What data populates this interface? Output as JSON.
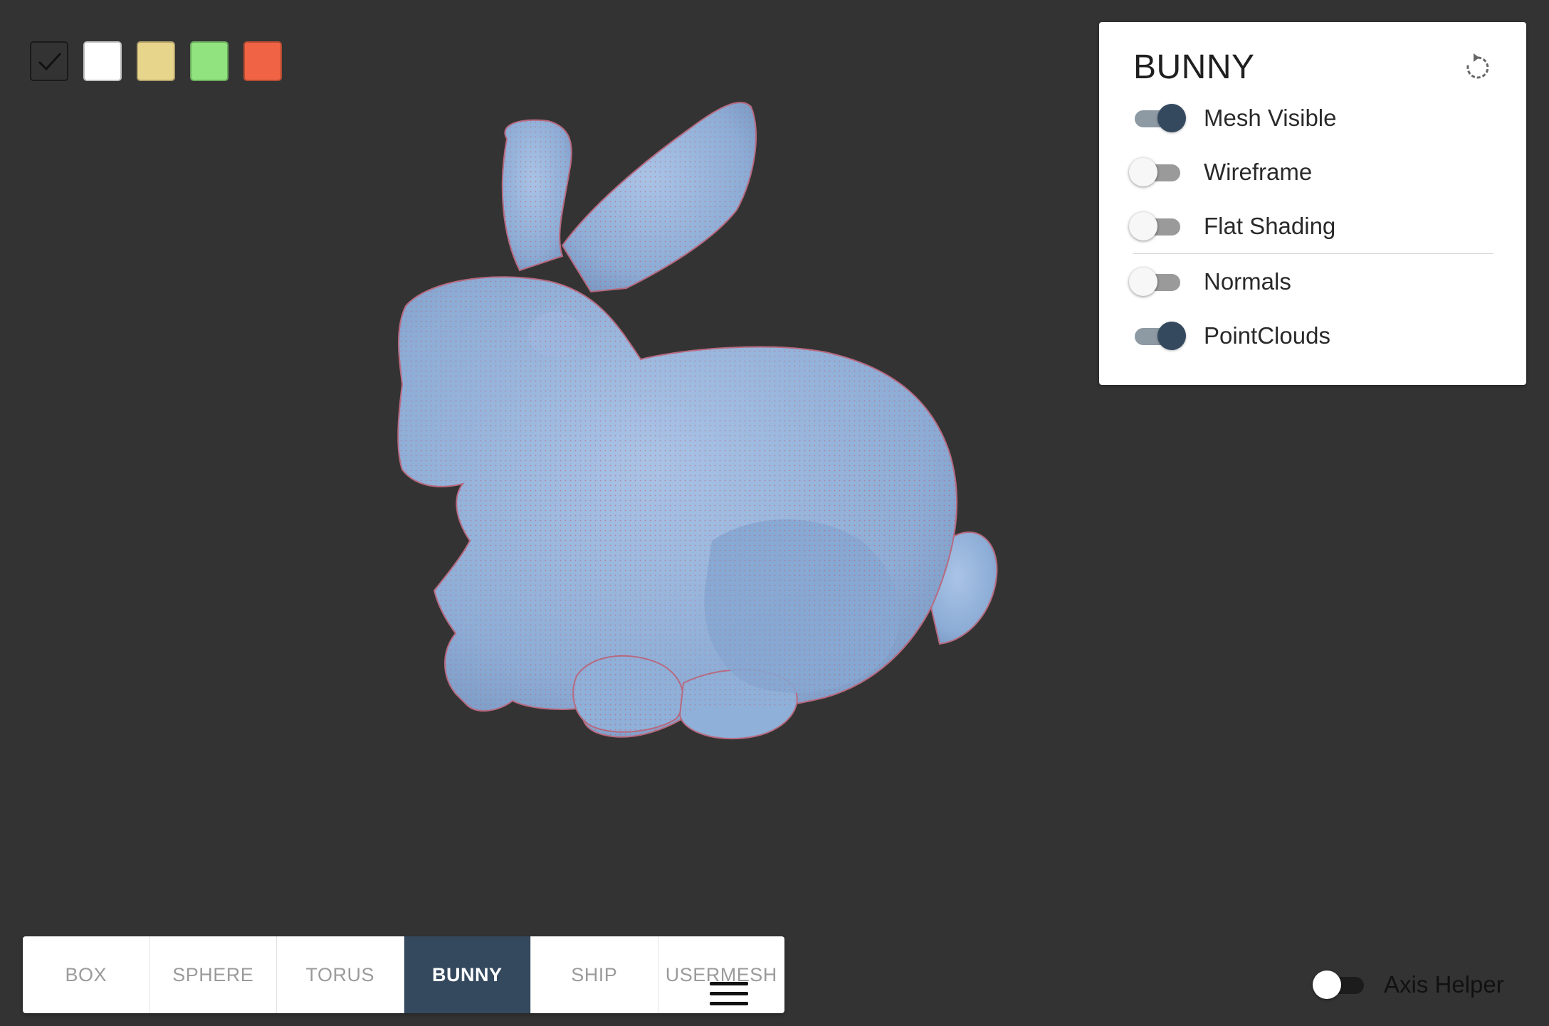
{
  "swatches": [
    {
      "name": "dark",
      "color": "#333333",
      "selected": true
    },
    {
      "name": "white",
      "color": "#ffffff",
      "selected": false
    },
    {
      "name": "yellow",
      "color": "#e8d58c",
      "selected": false
    },
    {
      "name": "green",
      "color": "#90e37e",
      "selected": false
    },
    {
      "name": "orange",
      "color": "#f06445",
      "selected": false
    }
  ],
  "viewport": {
    "model_color": "#8fb0d8",
    "point_color": "#c0566a",
    "background": "#333333"
  },
  "panel": {
    "title": "BUNNY",
    "reset_icon": "rotate-ccw-icon",
    "options": [
      {
        "label": "Mesh Visible",
        "on": true
      },
      {
        "label": "Wireframe",
        "on": false
      },
      {
        "label": "Flat Shading",
        "on": false
      },
      {
        "label": "Normals",
        "on": false
      },
      {
        "label": "PointClouds",
        "on": true
      }
    ]
  },
  "tabs": [
    {
      "label": "BOX",
      "active": false
    },
    {
      "label": "SPHERE",
      "active": false
    },
    {
      "label": "TORUS",
      "active": false
    },
    {
      "label": "BUNNY",
      "active": true
    },
    {
      "label": "SHIP",
      "active": false
    },
    {
      "label": "USERMESH",
      "active": false
    }
  ],
  "menu_icon": "hamburger-menu-icon",
  "axis_helper": {
    "label": "Axis Helper",
    "on": false
  },
  "accent_color": "#34495e"
}
